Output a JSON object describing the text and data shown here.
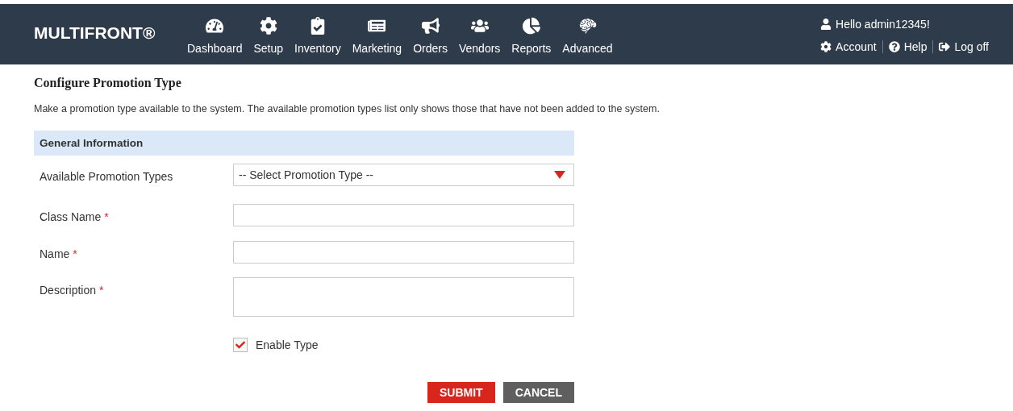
{
  "header": {
    "logo": "MULTIFRONT®",
    "nav": [
      {
        "label": "Dashboard"
      },
      {
        "label": "Setup"
      },
      {
        "label": "Inventory"
      },
      {
        "label": "Marketing"
      },
      {
        "label": "Orders"
      },
      {
        "label": "Vendors"
      },
      {
        "label": "Reports"
      },
      {
        "label": "Advanced"
      }
    ],
    "greeting": "Hello admin12345!",
    "links": [
      {
        "label": "Account"
      },
      {
        "label": "Help"
      },
      {
        "label": "Log off"
      }
    ]
  },
  "page": {
    "title": "Configure Promotion Type",
    "description": "Make a promotion type available to the system. The available promotion types list only shows those that have not been added to the system."
  },
  "form": {
    "section": "General Information",
    "fields": [
      {
        "kind": "select",
        "label": "Available Promotion Types",
        "value": "-- Select Promotion Type --"
      },
      {
        "kind": "text",
        "label": "Class Name",
        "required_mark": "*"
      },
      {
        "kind": "text",
        "label": "Name",
        "required_mark": "*"
      },
      {
        "kind": "textarea",
        "label": "Description",
        "required_mark": "*"
      }
    ],
    "checkbox": {
      "label": "Enable Type",
      "checked": true
    },
    "buttons": [
      {
        "kind": "primary",
        "label": "SUBMIT"
      },
      {
        "kind": "secondary",
        "label": "CANCEL"
      }
    ]
  }
}
